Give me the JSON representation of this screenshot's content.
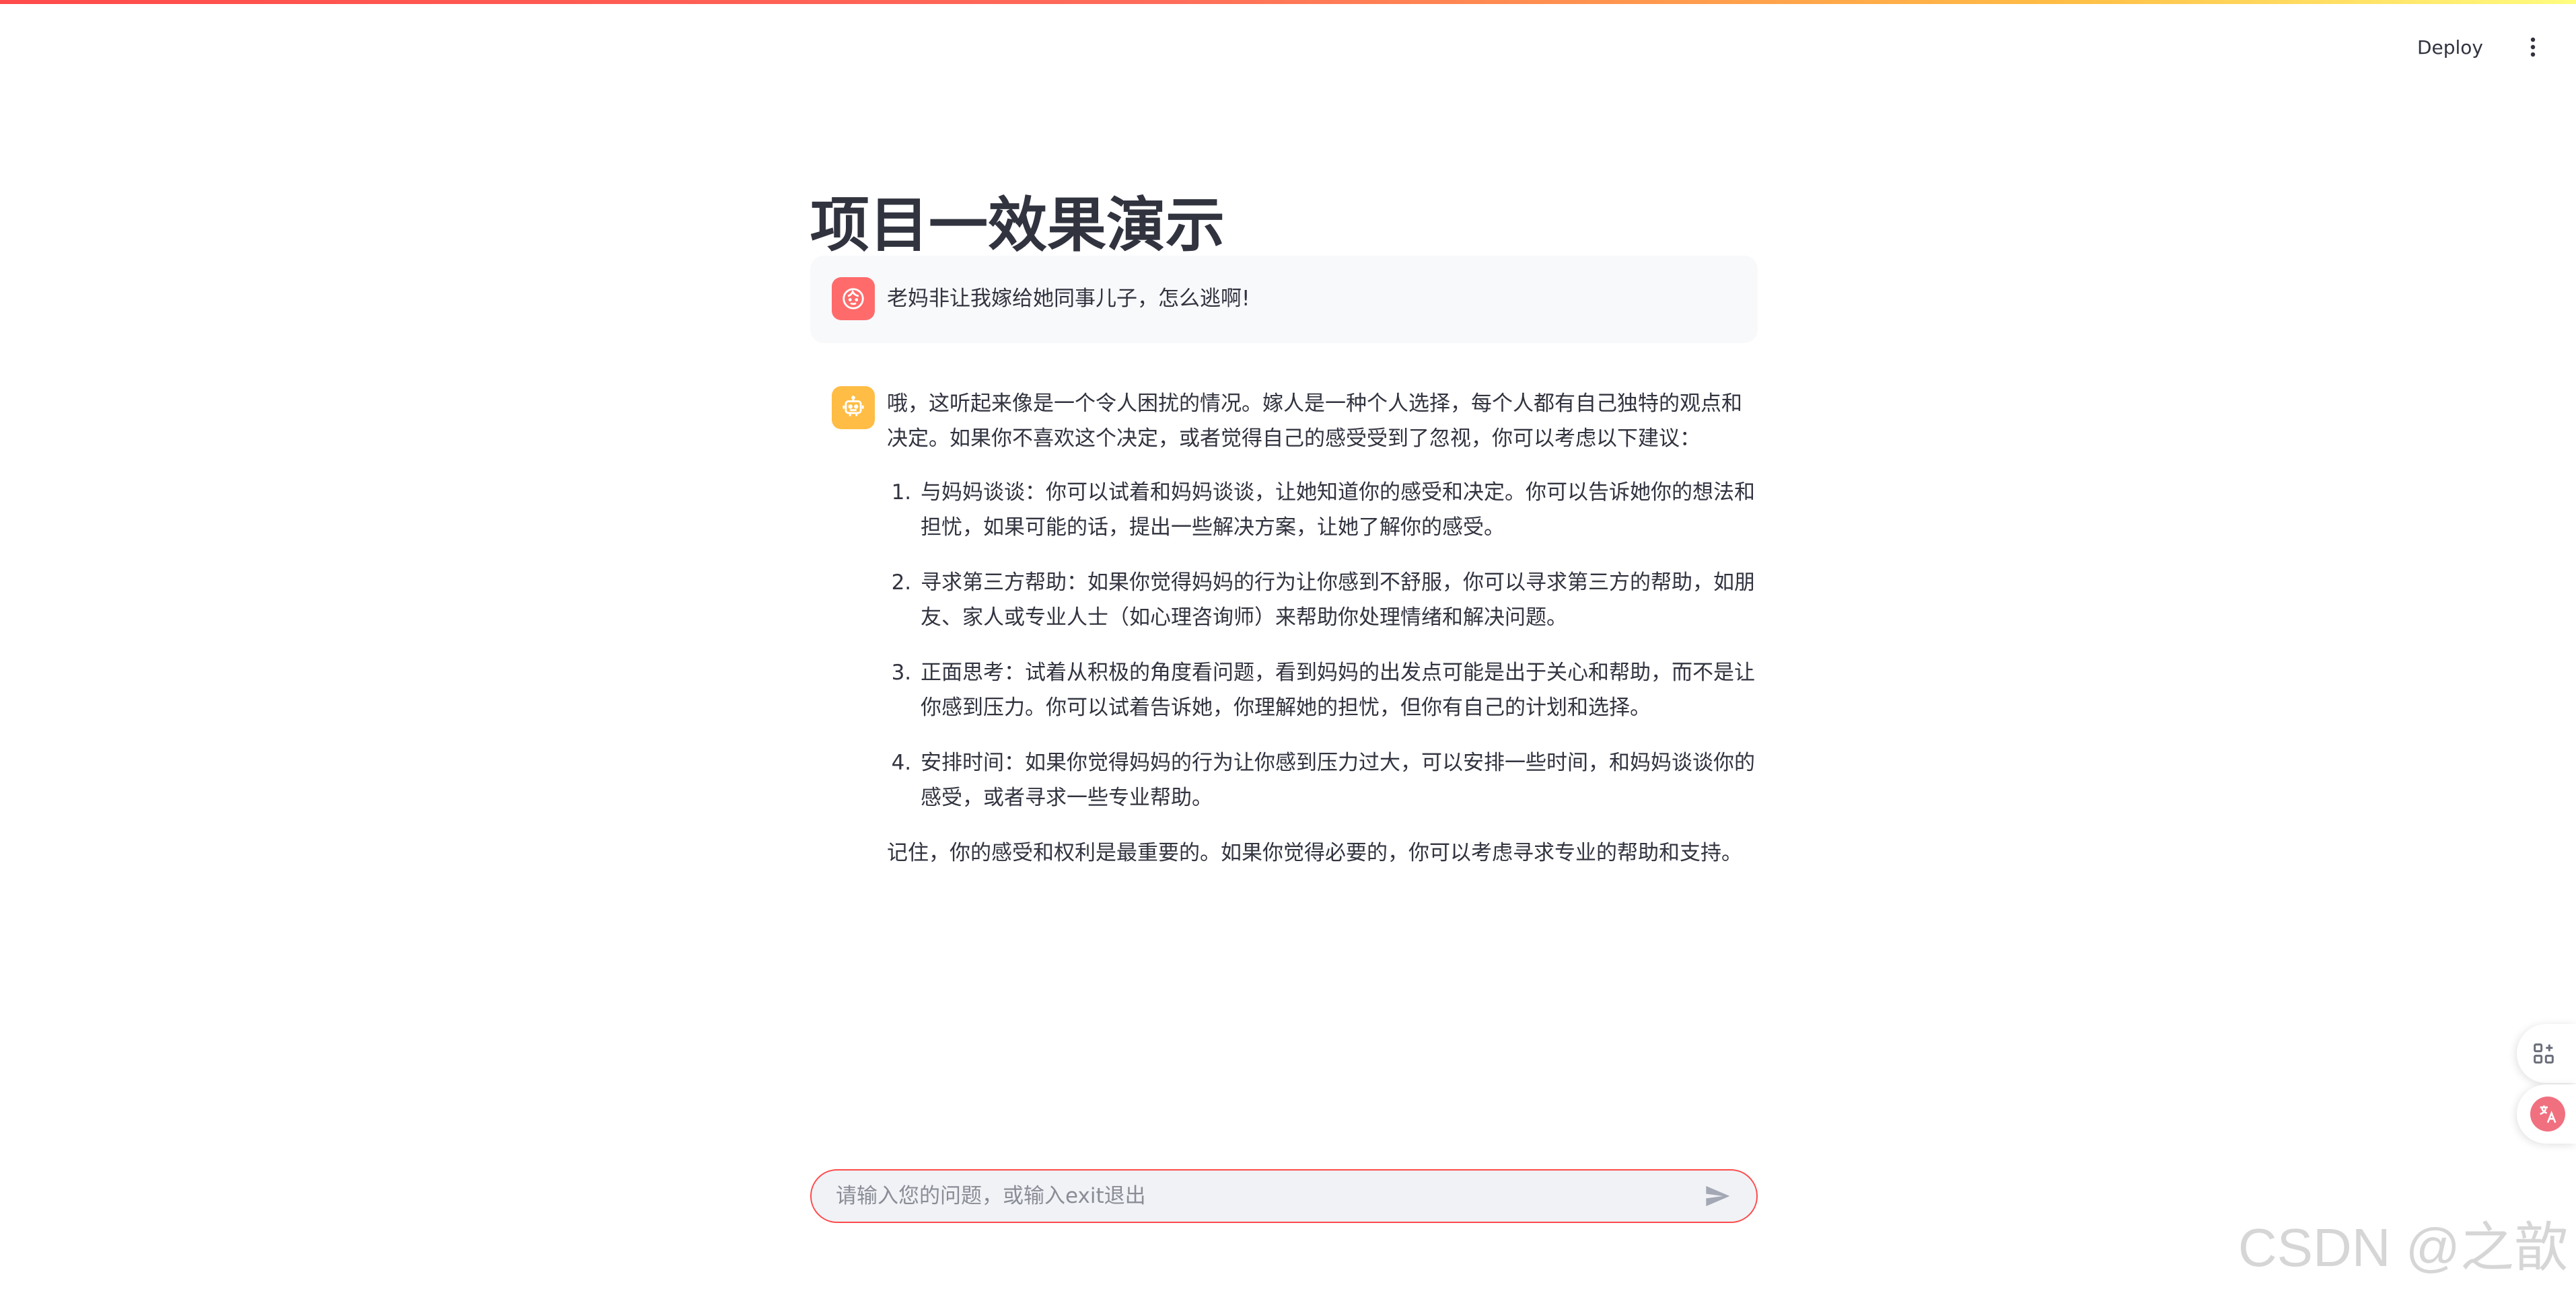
{
  "header": {
    "deploy_label": "Deploy",
    "menu_icon": "vertical-ellipsis-icon"
  },
  "main": {
    "title": "项目一效果演示"
  },
  "messages": {
    "user": {
      "avatar_icon": "user-face-icon",
      "text": "老妈非让我嫁给她同事儿子，怎么逃啊!"
    },
    "assistant": {
      "avatar_icon": "robot-icon",
      "intro": "哦，这听起来像是一个令人困扰的情况。嫁人是一种个人选择，每个人都有自己独特的观点和决定。如果你不喜欢这个决定，或者觉得自己的感受受到了忽视，你可以考虑以下建议：",
      "suggestions": [
        "与妈妈谈谈：你可以试着和妈妈谈谈，让她知道你的感受和决定。你可以告诉她你的想法和担忧，如果可能的话，提出一些解决方案，让她了解你的感受。",
        "寻求第三方帮助：如果你觉得妈妈的行为让你感到不舒服，你可以寻求第三方的帮助，如朋友、家人或专业人士（如心理咨询师）来帮助你处理情绪和解决问题。",
        "正面思考：试着从积极的角度看问题，看到妈妈的出发点可能是出于关心和帮助，而不是让你感到压力。你可以试着告诉她，你理解她的担忧，但你有自己的计划和选择。",
        "安排时间：如果你觉得妈妈的行为让你感到压力过大，可以安排一些时间，和妈妈谈谈你的感受，或者寻求一些专业帮助。"
      ],
      "closing": "记住，你的感受和权利是最重要的。如果你觉得必要的，你可以考虑寻求专业的帮助和支持。"
    }
  },
  "chat_input": {
    "placeholder": "请输入您的问题，或输入exit退出",
    "value": "",
    "send_icon": "send-arrow-icon"
  },
  "floating": {
    "apps_icon": "apps-add-icon",
    "translate_icon": "translate-icon"
  },
  "watermark": "CSDN @之歆",
  "colors": {
    "accent": "#ff4b4b",
    "user_avatar": "#ff6b6b",
    "assistant_avatar": "#ffbd45",
    "input_bg": "#f0f2f6",
    "user_message_bg": "#f8f9fb"
  }
}
